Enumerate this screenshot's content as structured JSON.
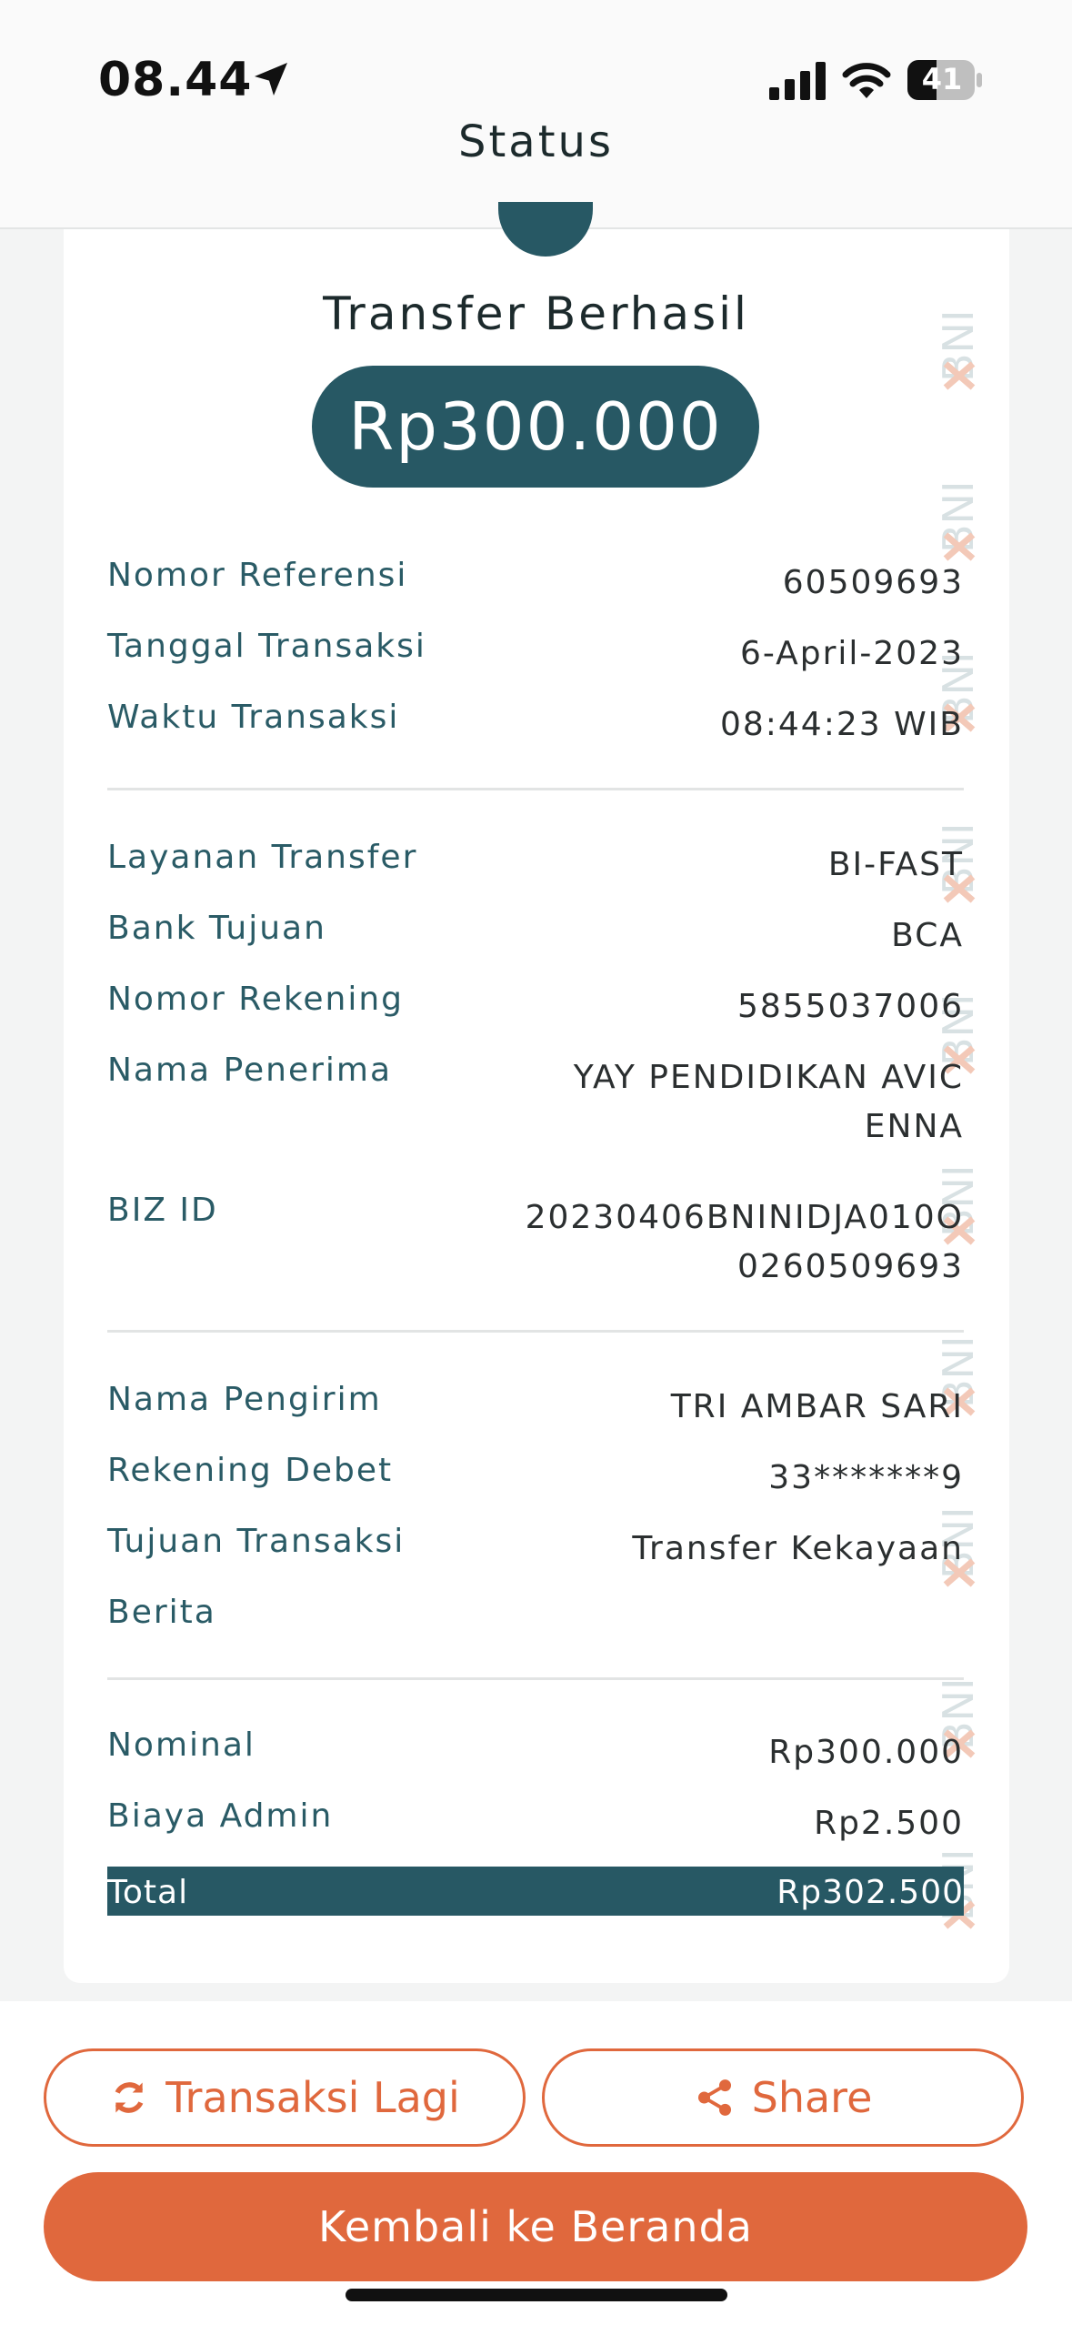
{
  "status_bar": {
    "time": "08.44",
    "battery": "41"
  },
  "header": {
    "title": "Status"
  },
  "receipt": {
    "title": "Transfer Berhasil",
    "amount": "Rp300.000",
    "watermark": "BNI",
    "section1": [
      {
        "label": "Nomor Referensi",
        "value": "60509693"
      },
      {
        "label": "Tanggal Transaksi",
        "value": "6-April-2023"
      },
      {
        "label": "Waktu Transaksi",
        "value": "08:44:23 WIB"
      }
    ],
    "section2": [
      {
        "label": "Layanan Transfer",
        "value": "BI-FAST"
      },
      {
        "label": "Bank Tujuan",
        "value": "BCA"
      },
      {
        "label": "Nomor Rekening",
        "value": "5855037006"
      },
      {
        "label": "Nama Penerima",
        "value": "YAY PENDIDIKAN AVICENNA"
      },
      {
        "label": "BIZ ID",
        "value": "20230406BNINIDJA010O0260509693"
      }
    ],
    "section3": [
      {
        "label": "Nama Pengirim",
        "value": "TRI AMBAR SARI"
      },
      {
        "label": "Rekening Debet",
        "value": "33*******9"
      },
      {
        "label": "Tujuan Transaksi",
        "value": "Transfer Kekayaan"
      },
      {
        "label": "Berita",
        "value": ""
      }
    ],
    "section4": [
      {
        "label": "Nominal",
        "value": "Rp300.000"
      },
      {
        "label": "Biaya Admin",
        "value": "Rp2.500"
      }
    ],
    "total": {
      "label": "Total",
      "value": "Rp302.500"
    }
  },
  "actions": {
    "repeat_label": "Transaksi Lagi",
    "share_label": "Share",
    "home_label": "Kembali ke Beranda"
  },
  "colors": {
    "primary": "#275864",
    "accent": "#e0683d",
    "label": "#2a5b66"
  },
  "icons": [
    "location-arrow-icon",
    "cellular-signal-icon",
    "wifi-icon",
    "battery-icon",
    "refresh-icon",
    "share-icon"
  ]
}
